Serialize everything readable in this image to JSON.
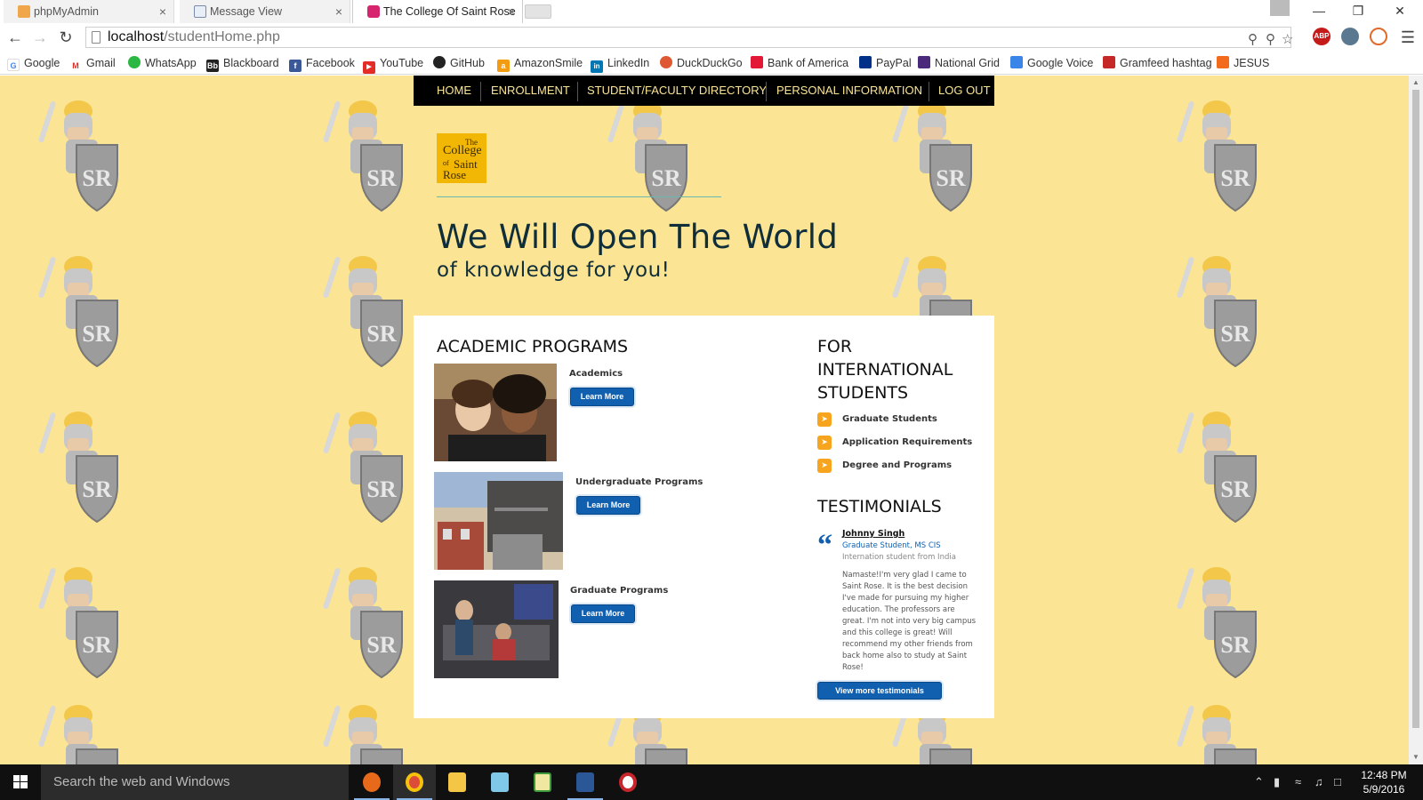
{
  "browser": {
    "tabs": [
      {
        "title": "phpMyAdmin",
        "active": false
      },
      {
        "title": "Message View",
        "active": false
      },
      {
        "title": "The College Of Saint Rose",
        "active": true
      }
    ],
    "close_glyph": "×",
    "url_host": "localhost",
    "url_path": "/studentHome.php",
    "extensions": {
      "adblock": "ABP"
    },
    "bookmarks": [
      "Google",
      "Gmail",
      "WhatsApp",
      "Blackboard",
      "Facebook",
      "YouTube",
      "GitHub",
      "AmazonSmile",
      "LinkedIn",
      "DuckDuckGo",
      "Bank of America",
      "PayPal",
      "National Grid",
      "Google Voice",
      "Gramfeed hashtag",
      "JESUS"
    ],
    "bookmark_icons": {
      "facebook": "f",
      "linkedin": "in",
      "amazon": "a",
      "blackboard": "Bb",
      "youtube": "▶",
      "gmail": "M"
    }
  },
  "site": {
    "nav": [
      "HOME",
      "ENROLLMENT",
      "STUDENT/FACULTY DIRECTORY",
      "PERSONAL INFORMATION",
      "LOG OUT"
    ],
    "logo_lines": [
      "The",
      "College",
      "of",
      "Saint",
      "Rose"
    ],
    "hero_title": "We Will Open The World",
    "hero_subtitle": "of knowledge for you!",
    "academic_title": "ACADEMIC PROGRAMS",
    "programs": [
      {
        "name": "Academics",
        "button": "Learn More"
      },
      {
        "name": "Undergraduate Programs",
        "button": "Learn More"
      },
      {
        "name": "Graduate Programs",
        "button": "Learn More"
      }
    ],
    "intl_title": "FOR INTERNATIONAL STUDENTS",
    "intl_links": [
      "Graduate Students",
      "Application Requirements",
      "Degree and Programs"
    ],
    "testimonials_title": "TESTIMONIALS",
    "testimonial": {
      "name": "Johnny Singh",
      "role": "Graduate Student, MS CIS",
      "origin": "Internation student from India",
      "text": "Namaste!I'm very glad I came to Saint Rose. It is the best decision I've made for pursuing my higher education. The professors are great. I'm not into very big campus and this college is great! Will recommend my other friends from back home also to study at Saint Rose!",
      "more_button": "View more testimonials"
    },
    "colors": {
      "background": "#fbe594",
      "nav_bg": "#000000",
      "nav_text": "#fbe594",
      "button": "#1160b0",
      "heading": "#0f2e3a",
      "arrow": "#f7a51e"
    }
  },
  "taskbar": {
    "search_placeholder": "Search the web and Windows",
    "time": "12:48 PM",
    "date": "5/9/2016",
    "apps": [
      "firefox-icon",
      "chrome-icon",
      "file-explorer-icon",
      "app-icon",
      "spreadsheet-icon",
      "word-icon",
      "media-icon"
    ]
  }
}
